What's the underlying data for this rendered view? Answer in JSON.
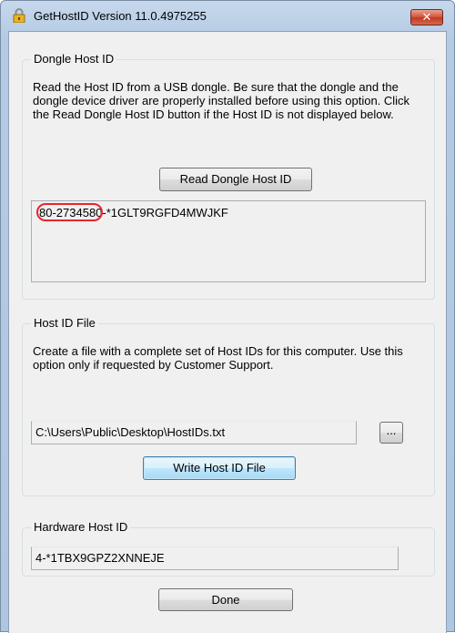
{
  "window": {
    "title": "GetHostID Version 11.0.4975255",
    "close_glyph": "✕"
  },
  "dongle": {
    "group_label": "Dongle Host ID",
    "description": "Read the Host ID from a USB dongle.  Be sure that the dongle and the dongle device driver are properly installed before using this option.  Click the Read Dongle Host ID button if the Host ID is not displayed below.",
    "read_button_label": "Read Dongle Host ID",
    "id_part1": "80-27345",
    "id_part2": "80-*1GLT9RGFD4MWJKF"
  },
  "hostid_file": {
    "group_label": "Host ID File",
    "description": "Create a file with a complete set of Host IDs for this computer. Use this option only if requested by Customer Support.",
    "path_value": "C:\\Users\\Public\\Desktop\\HostIDs.txt",
    "browse_label": "...",
    "write_button_label": "Write Host ID File"
  },
  "hardware": {
    "group_label": "Hardware Host ID",
    "value": "4-*1TBX9GPZ2XNNEJE"
  },
  "done_label": "Done",
  "colors": {
    "highlight": "#e8262a",
    "close_button": "#c7432b",
    "dialog_bg": "#f0f0f0"
  }
}
